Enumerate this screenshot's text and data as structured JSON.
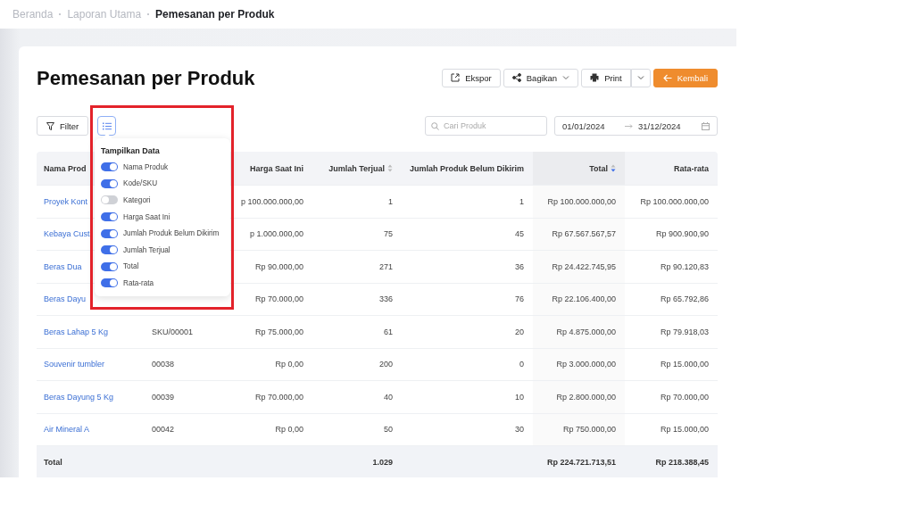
{
  "breadcrumb": [
    {
      "label": "Beranda",
      "current": false
    },
    {
      "label": "Laporan Utama",
      "current": false
    },
    {
      "label": "Pemesanan per Produk",
      "current": true
    }
  ],
  "title": "Pemesanan per Produk",
  "actions": [
    {
      "kind": "export",
      "label": "Ekspor"
    },
    {
      "kind": "share",
      "label": "Bagikan"
    },
    {
      "kind": "print",
      "label": "Print"
    },
    {
      "kind": "more"
    },
    {
      "kind": "back",
      "label": "Kembali"
    }
  ],
  "filter_button": "Filter",
  "search": {
    "placeholder": "Cari Produk"
  },
  "date_range": {
    "start": "01/01/2024",
    "end": "31/12/2024"
  },
  "popover": {
    "title": "Tampilkan Data",
    "items": [
      {
        "label": "Nama Produk",
        "on": true
      },
      {
        "label": "Kode/SKU",
        "on": true
      },
      {
        "label": "Kategori",
        "on": false
      },
      {
        "label": "Harga Saat Ini",
        "on": true
      },
      {
        "label": "Jumlah Produk Belum Dikirim",
        "on": true
      },
      {
        "label": "Jumlah Terjual",
        "on": true
      },
      {
        "label": "Total",
        "on": true
      },
      {
        "label": "Rata-rata",
        "on": true
      }
    ]
  },
  "table": {
    "columns": [
      {
        "label": "Nama Prod"
      },
      {},
      {
        "label": "Harga Saat Ini"
      },
      {
        "label": "Jumlah Terjual",
        "sortable": true,
        "sorted": false
      },
      {
        "label": "Jumlah Produk Belum Dikirim"
      },
      {
        "label": "Total",
        "sortable": true,
        "sorted": true
      },
      {
        "label": "Rata-rata"
      }
    ],
    "rows": [
      {
        "name": "Proyek Kont",
        "price": "p 100.000.000,00",
        "sold": "1",
        "unsent": "1",
        "total": "Rp 100.000.000,00",
        "average": "Rp 100.000.000,00"
      },
      {
        "name": "Kebaya Cust",
        "price": "p 1.000.000,00",
        "sold": "75",
        "unsent": "45",
        "total": "Rp 67.567.567,57",
        "average": "Rp 900.900,90"
      },
      {
        "name": "Beras Dua",
        "price": "Rp 90.000,00",
        "sold": "271",
        "unsent": "36",
        "total": "Rp 24.422.745,95",
        "average": "Rp 90.120,83"
      },
      {
        "name": "Beras Dayu",
        "price": "Rp 70.000,00",
        "sold": "336",
        "unsent": "76",
        "total": "Rp 22.106.400,00",
        "average": "Rp 65.792,86"
      },
      {
        "name": "Beras Lahap 5 Kg",
        "sku": "SKU/00001",
        "price": "Rp 75.000,00",
        "sold": "61",
        "unsent": "20",
        "total": "Rp 4.875.000,00",
        "average": "Rp 79.918,03"
      },
      {
        "name": "Souvenir tumbler",
        "sku": "00038",
        "price": "Rp 0,00",
        "sold": "200",
        "unsent": "0",
        "total": "Rp 3.000.000,00",
        "average": "Rp 15.000,00"
      },
      {
        "name": "Beras Dayung 5 Kg",
        "sku": "00039",
        "price": "Rp 70.000,00",
        "sold": "40",
        "unsent": "10",
        "total": "Rp 2.800.000,00",
        "average": "Rp 70.000,00"
      },
      {
        "name": "Air Mineral A",
        "sku": "00042",
        "price": "Rp 0,00",
        "sold": "50",
        "unsent": "30",
        "total": "Rp 750.000,00",
        "average": "Rp 15.000,00"
      }
    ],
    "totals": {
      "label": "Total",
      "sold": "1.029",
      "total": "Rp 224.721.713,51",
      "average": "Rp 218.388,45"
    }
  }
}
